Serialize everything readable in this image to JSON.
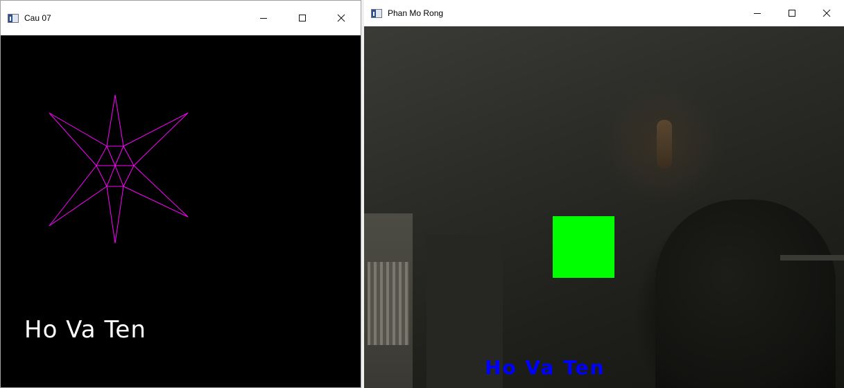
{
  "windows": [
    {
      "title": "Cau 07",
      "canvas_text": "Ho Va Ten",
      "star_color": "#ff00ff",
      "text_color": "#ffffff"
    },
    {
      "title": "Phan Mo Rong",
      "canvas_text": "Ho Va Ten",
      "rect_color": "#00ff00",
      "text_color": "#0000ff"
    }
  ],
  "icons": {
    "minimize": "minimize-icon",
    "maximize": "maximize-icon",
    "close": "close-icon",
    "app": "app-window-icon"
  }
}
